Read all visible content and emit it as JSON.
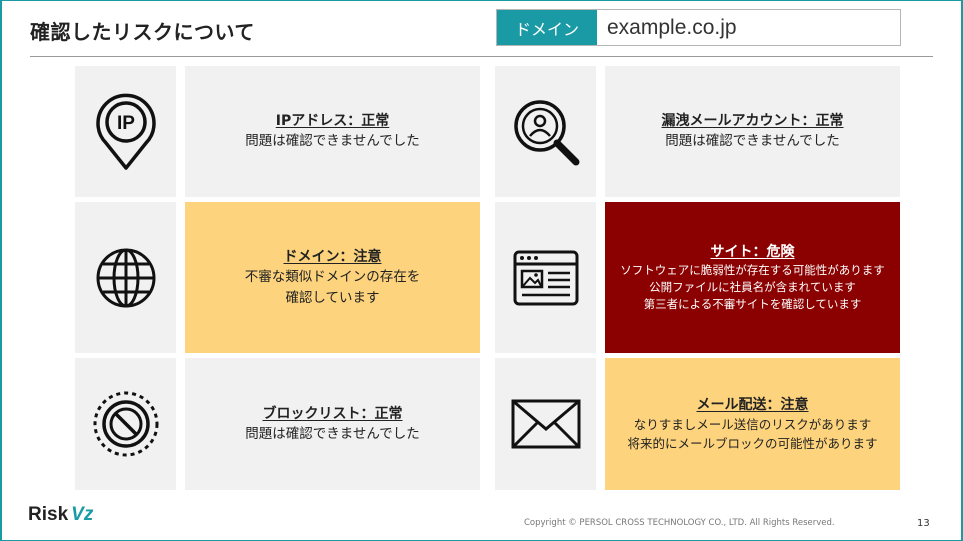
{
  "header": {
    "title": "確認したリスクについて",
    "domain_label": "ドメイン",
    "domain_value": "example.co.jp"
  },
  "items": [
    {
      "icon": "ip-pin-icon",
      "title": "IPアドレス：正常",
      "lines": [
        "問題は確認できませんでした"
      ],
      "status": "normal"
    },
    {
      "icon": "magnifier-user-icon",
      "title": "漏洩メールアカウント：正常",
      "lines": [
        "問題は確認できませんでした"
      ],
      "status": "normal"
    },
    {
      "icon": "globe-icon",
      "title": "ドメイン：注意",
      "lines": [
        "不審な類似ドメインの存在を",
        "確認しています"
      ],
      "status": "caution"
    },
    {
      "icon": "browser-window-icon",
      "title": "サイト：危険",
      "lines": [
        "ソフトウェアに脆弱性が存在する可能性があります",
        "公開ファイルに社員名が含まれています",
        "第三者による不審サイトを確認しています"
      ],
      "status": "danger"
    },
    {
      "icon": "blocked-circle-icon",
      "title": "ブロックリスト：正常",
      "lines": [
        "問題は確認できませんでした"
      ],
      "status": "normal"
    },
    {
      "icon": "envelope-icon",
      "title": "メール配送：注意",
      "lines": [
        "なりすましメール送信のリスクがあります",
        "将来的にメールブロックの可能性があります"
      ],
      "status": "caution"
    }
  ],
  "colors": {
    "accent": "#1a9aa5",
    "caution": "#fdd47d",
    "danger": "#8b0000",
    "cell_bg": "#f1f1f1"
  },
  "footer": {
    "logo_main": "Risk",
    "logo_sub": "Vz",
    "copyright": "Copyright © PERSOL CROSS TECHNOLOGY CO., LTD. All Rights Reserved.",
    "page_number": "13"
  }
}
